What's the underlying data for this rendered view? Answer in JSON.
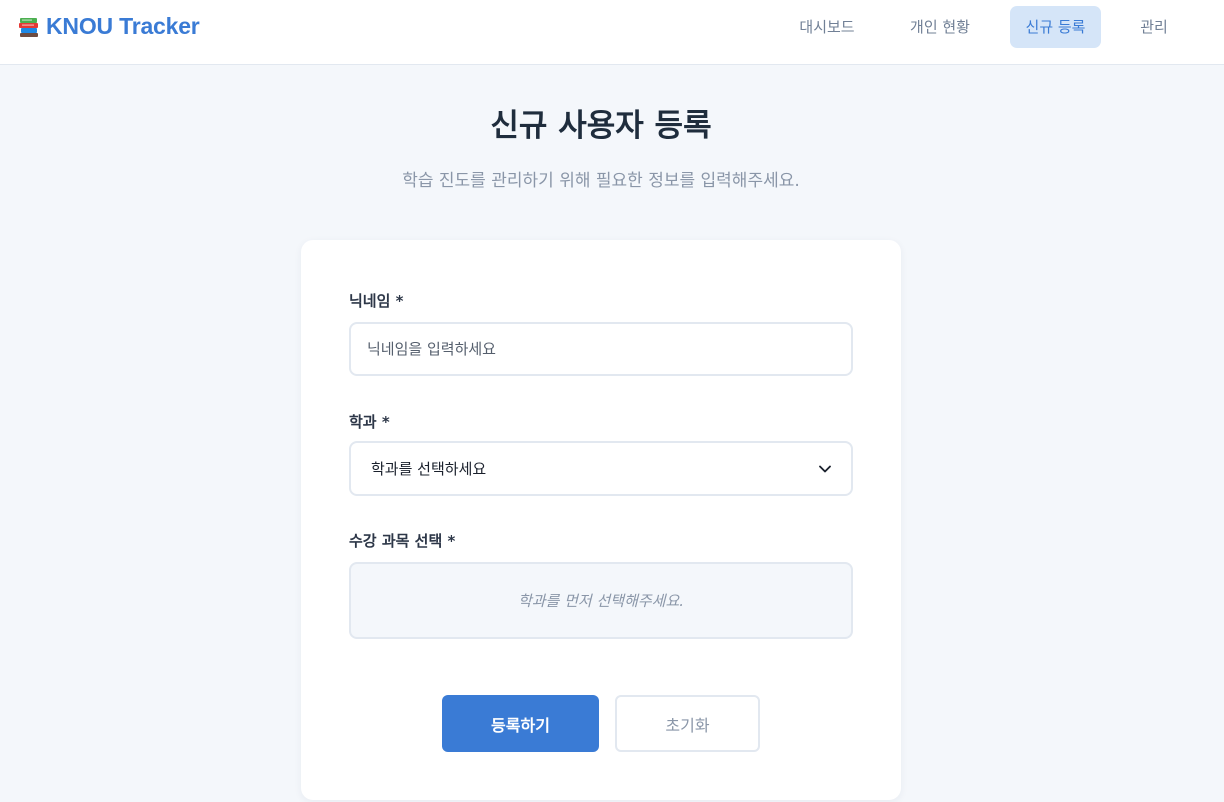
{
  "header": {
    "brand": "KNOU Tracker",
    "brand_icon": "books-icon",
    "nav": [
      {
        "label": "대시보드",
        "active": false
      },
      {
        "label": "개인 현황",
        "active": false
      },
      {
        "label": "신규 등록",
        "active": true
      },
      {
        "label": "관리",
        "active": false
      }
    ]
  },
  "page": {
    "title": "신규 사용자 등록",
    "subtitle": "학습 진도를 관리하기 위해 필요한 정보를 입력해주세요."
  },
  "form": {
    "nickname_label": "닉네임 *",
    "nickname_placeholder": "닉네임을 입력하세요",
    "nickname_value": "",
    "department_label": "학과 *",
    "department_selected": "학과를 선택하세요",
    "course_label": "수강 과목 선택 *",
    "course_empty_message": "학과를 먼저 선택해주세요.",
    "submit_label": "등록하기",
    "reset_label": "초기화"
  },
  "colors": {
    "accent": "#3a7bd5",
    "active_nav_bg": "#d5e5f8",
    "page_bg": "#f4f7fb"
  }
}
